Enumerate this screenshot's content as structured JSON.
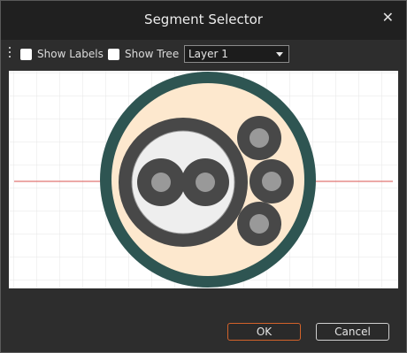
{
  "dialog": {
    "title": "Segment Selector",
    "close_icon": "close-icon"
  },
  "toolbar": {
    "grip_icon": "grip-dots-icon",
    "show_labels": {
      "label": "Show Labels",
      "checked": false
    },
    "show_tree": {
      "label": "Show Tree",
      "checked": false
    },
    "layer_select": {
      "value": "Layer 1",
      "icon": "chevron-down-icon"
    }
  },
  "buttons": {
    "ok": "OK",
    "cancel": "Cancel"
  },
  "colors": {
    "outer_jacket": "#2e5552",
    "filler": "#fde8ce",
    "conductor_ring": "#484848",
    "conductor_core": "#999999",
    "inner_insulation": "#eeeeee",
    "centerline": "#d9534f",
    "accent_ok": "#d2622a"
  }
}
